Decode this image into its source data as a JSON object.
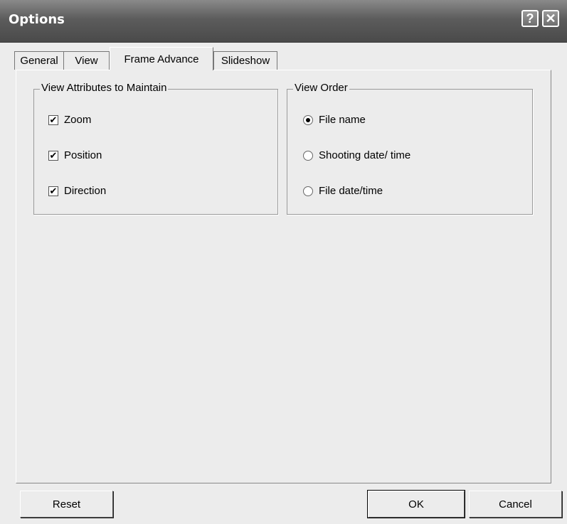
{
  "window": {
    "title": "Options"
  },
  "titlebar": {
    "help": "?",
    "close": "✕"
  },
  "tabs": [
    {
      "label": "General"
    },
    {
      "label": "View"
    },
    {
      "label": "Frame Advance",
      "active": true
    },
    {
      "label": "Slideshow"
    }
  ],
  "view_attributes": {
    "legend": "View Attributes to Maintain",
    "items": [
      {
        "label": "Zoom",
        "checked": true
      },
      {
        "label": "Position",
        "checked": true
      },
      {
        "label": "Direction",
        "checked": true
      }
    ]
  },
  "view_order": {
    "legend": "View Order",
    "selected": "File name",
    "options": [
      {
        "label": "File name"
      },
      {
        "label": "Shooting date/ time"
      },
      {
        "label": "File date/time"
      }
    ]
  },
  "buttons": {
    "reset": "Reset",
    "ok": "OK",
    "cancel": "Cancel"
  },
  "check_mark": "✔"
}
